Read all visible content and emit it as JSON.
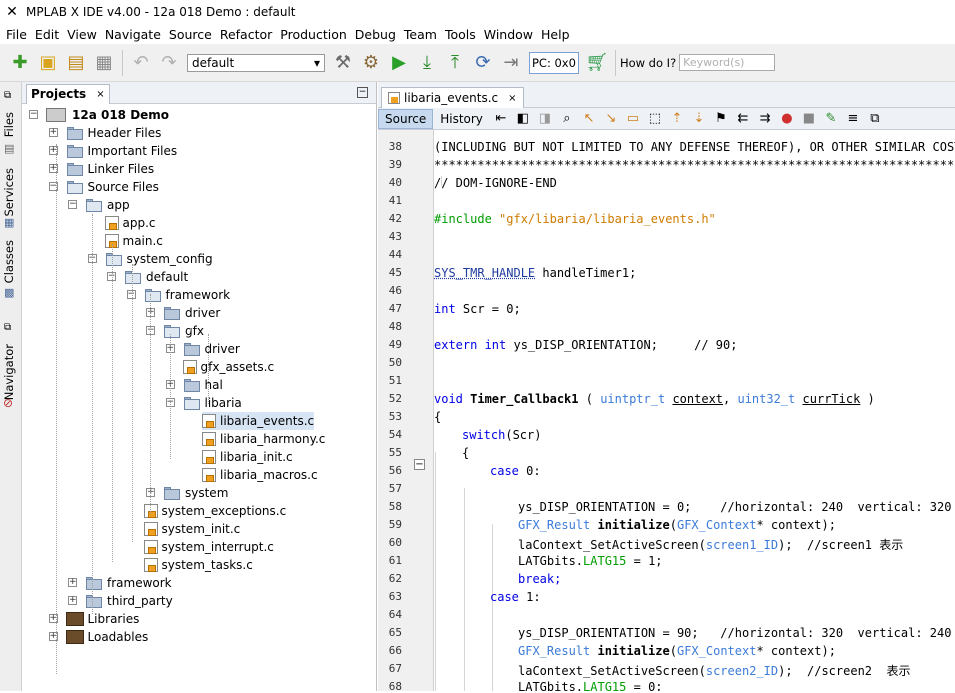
{
  "window": {
    "title": "MPLAB X IDE v4.00 - 12a 018 Demo : default"
  },
  "menu": [
    "File",
    "Edit",
    "View",
    "Navigate",
    "Source",
    "Refactor",
    "Production",
    "Debug",
    "Team",
    "Tools",
    "Window",
    "Help"
  ],
  "toolbar": {
    "config": "default",
    "pc": "PC: 0x0",
    "howdoi": "How do I?",
    "search_placeholder": "Keyword(s)"
  },
  "side_tabs": [
    "Files",
    "Services",
    "Classes",
    "Navigator"
  ],
  "projects": {
    "tab": "Projects",
    "close": "×",
    "tree": [
      {
        "label": "12a 018 Demo",
        "bold": true
      },
      {
        "label": "Header Files"
      },
      {
        "label": "Important Files"
      },
      {
        "label": "Linker Files"
      },
      {
        "label": "Source Files"
      },
      {
        "label": "app"
      },
      {
        "label": "app.c"
      },
      {
        "label": "main.c"
      },
      {
        "label": "system_config"
      },
      {
        "label": "default"
      },
      {
        "label": "framework"
      },
      {
        "label": "driver"
      },
      {
        "label": "gfx"
      },
      {
        "label": "driver"
      },
      {
        "label": "gfx_assets.c"
      },
      {
        "label": "hal"
      },
      {
        "label": "libaria"
      },
      {
        "label": "libaria_events.c"
      },
      {
        "label": "libaria_harmony.c"
      },
      {
        "label": "libaria_init.c"
      },
      {
        "label": "libaria_macros.c"
      },
      {
        "label": "system"
      },
      {
        "label": "system_exceptions.c"
      },
      {
        "label": "system_init.c"
      },
      {
        "label": "system_interrupt.c"
      },
      {
        "label": "system_tasks.c"
      },
      {
        "label": "framework"
      },
      {
        "label": "third_party"
      },
      {
        "label": "Libraries"
      },
      {
        "label": "Loadables"
      }
    ]
  },
  "editor": {
    "tab": "libaria_events.c",
    "close": "×",
    "source": "Source",
    "history": "History",
    "lines": [
      "38",
      "39",
      "40",
      "41",
      "42",
      "43",
      "44",
      "45",
      "46",
      "47",
      "48",
      "49",
      "50",
      "51",
      "52",
      "53",
      "54",
      "55",
      "56",
      "57",
      "58",
      "59",
      "60",
      "61",
      "62",
      "63",
      "64",
      "65",
      "66",
      "67",
      "68"
    ],
    "code": {
      "l38": "(INCLUDING BUT NOT LIMITED TO ANY DEFENSE THEREOF), OR OTHER SIMILAR COSTS",
      "l39": "*******************************************************************************",
      "l40": "// DOM-IGNORE-END",
      "l42a": "#include ",
      "l42b": "\"gfx/libaria/libaria_events.h\"",
      "l45a": "SYS_TMR_HANDLE",
      "l45b": " handleTimer1;",
      "l47a": "int",
      "l47b": " Scr = 0;",
      "l49a": "extern int",
      "l49b": " ys_DISP_ORIENTATION;     // 90;",
      "l52a": "void ",
      "l52b": "Timer_Callback1",
      "l52c": " ( ",
      "l52d": "uintptr_t",
      "l52e": " ",
      "l52f": "context",
      "l52g": ", ",
      "l52h": "uint32_t",
      "l52i": " ",
      "l52j": "currTick",
      "l52k": " )",
      "l53": "{",
      "l54a": "switch",
      "l54b": "(Scr)",
      "l55": "{",
      "l56a": "case",
      "l56b": " 0:",
      "l58": "ys_DISP_ORIENTATION = 0;    //horizontal: 240  vertical: 320",
      "l59a": "GFX_Result",
      "l59b": " ",
      "l59c": "initialize",
      "l59d": "(",
      "l59e": "GFX_Context",
      "l59f": "* context);",
      "l60a": "laContext_SetActiveScreen(",
      "l60b": "screen1_ID",
      "l60c": ");  //screen1 表示",
      "l61a": "LATGbits.",
      "l61b": "LATG15",
      "l61c": " = 1;",
      "l62": "break;",
      "l63a": "case",
      "l63b": " 1:",
      "l65": "ys_DISP_ORIENTATION = 90;   //horizontal: 320  vertical: 240",
      "l66a": "GFX_Result",
      "l66b": " ",
      "l66c": "initialize",
      "l66d": "(",
      "l66e": "GFX_Context",
      "l66f": "* context);",
      "l67a": "laContext_SetActiveScreen(",
      "l67b": "screen2_ID",
      "l67c": ");  //screen2  表示",
      "l68a": "LATGbits.",
      "l68b": "LATG15",
      "l68c": " = 0;"
    }
  }
}
